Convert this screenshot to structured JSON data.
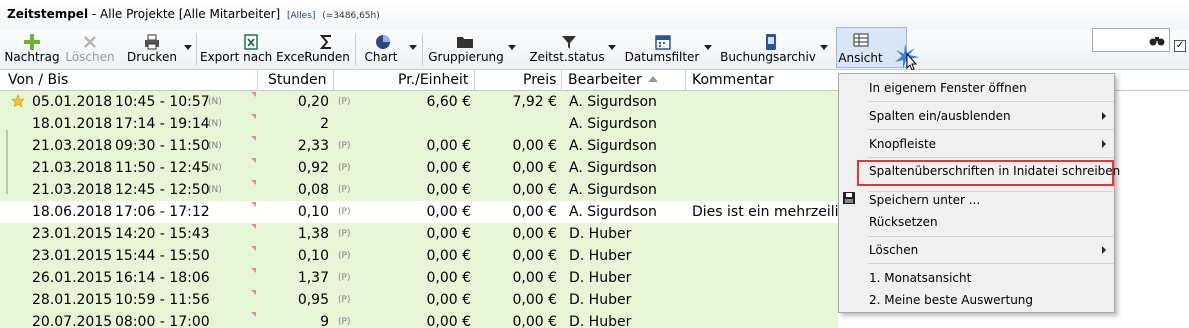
{
  "title": {
    "bold": "Zeitstempel",
    "text": "- Alle Projekte [Alle Mitarbeiter]",
    "filter_tag": "[Alles]",
    "total": "(=3486,65h)"
  },
  "toolbar": {
    "nachtrag": "Nachtrag",
    "loeschen": "Löschen",
    "drucken": "Drucken",
    "export": "Export nach Excel",
    "runden": "Runden",
    "chart": "Chart",
    "gruppierung": "Gruppierung",
    "zeitstatus": "Zeitst.status",
    "datumsfilter": "Datumsfilter",
    "buchungsarchiv": "Buchungsarchiv",
    "ansicht": "Ansicht"
  },
  "columns": {
    "von_bis": "Von / Bis",
    "stunden": "Stunden",
    "pr_einheit": "Pr./Einheit",
    "preis": "Preis",
    "bearbeiter": "Bearbeiter",
    "kommentar": "Kommentar"
  },
  "rows": [
    {
      "date": "05.01.2018",
      "time": "10:45 - 10:57",
      "tag": "(N)",
      "hours": "0,20",
      "htag": "(P)",
      "unit": "6,60 €",
      "price": "7,92 €",
      "user": "A. Sigurdson",
      "comment": ""
    },
    {
      "date": "18.01.2018",
      "time": "17:14 - 19:14",
      "tag": "(N)",
      "hours": "2",
      "htag": "",
      "unit": "",
      "price": "",
      "user": "A. Sigurdson",
      "comment": ""
    },
    {
      "date": "21.03.2018",
      "time": "09:30 - 11:50",
      "tag": "(N)",
      "hours": "2,33",
      "htag": "(P)",
      "unit": "0,00 €",
      "price": "0,00 €",
      "user": "A. Sigurdson",
      "comment": ""
    },
    {
      "date": "21.03.2018",
      "time": "11:50 - 12:45",
      "tag": "(N)",
      "hours": "0,92",
      "htag": "(P)",
      "unit": "0,00 €",
      "price": "0,00 €",
      "user": "A. Sigurdson",
      "comment": ""
    },
    {
      "date": "21.03.2018",
      "time": "12:45 - 12:50",
      "tag": "(N)",
      "hours": "0,08",
      "htag": "(P)",
      "unit": "0,00 €",
      "price": "0,00 €",
      "user": "A. Sigurdson",
      "comment": ""
    },
    {
      "date": "18.06.2018",
      "time": "17:06 - 17:12",
      "tag": "",
      "hours": "0,10",
      "htag": "(P)",
      "unit": "0,00 €",
      "price": "0,00 €",
      "user": "A. Sigurdson",
      "comment": "Dies ist ein mehrzeilig"
    },
    {
      "date": "23.01.2015",
      "time": "14:20 - 15:43",
      "tag": "",
      "hours": "1,38",
      "htag": "(P)",
      "unit": "0,00 €",
      "price": "0,00 €",
      "user": "D. Huber",
      "comment": ""
    },
    {
      "date": "23.01.2015",
      "time": "15:44 - 15:50",
      "tag": "",
      "hours": "0,10",
      "htag": "(P)",
      "unit": "0,00 €",
      "price": "0,00 €",
      "user": "D. Huber",
      "comment": ""
    },
    {
      "date": "26.01.2015",
      "time": "16:14 - 18:06",
      "tag": "",
      "hours": "1,37",
      "htag": "(P)",
      "unit": "0,00 €",
      "price": "0,00 €",
      "user": "D. Huber",
      "comment": ""
    },
    {
      "date": "28.01.2015",
      "time": "10:59 - 11:56",
      "tag": "",
      "hours": "0,95",
      "htag": "(P)",
      "unit": "0,00 €",
      "price": "0,00 €",
      "user": "D. Huber",
      "comment": ""
    },
    {
      "date": "20.07.2015",
      "time": "08:00 - 17:00",
      "tag": "",
      "hours": "9",
      "htag": "(P)",
      "unit": "0,00 €",
      "price": "0,00 €",
      "user": "D. Huber",
      "comment": ""
    }
  ],
  "menu": {
    "open_window": "In eigenem Fenster öffnen",
    "columns_toggle": "Spalten ein/ausblenden",
    "knopfleiste": "Knopfleiste",
    "write_headers": "Spaltenüberschriften in Inidatei schreiben",
    "save_as": "Speichern unter ...",
    "reset": "Rücksetzen",
    "delete": "Löschen",
    "view1": "1. Monatsansicht",
    "view2": "2. Meine beste Auswertung"
  },
  "colors": {
    "row_green": "#e8f6d8",
    "highlight_border": "#e0373a",
    "menu_bg": "#f0f0f0"
  }
}
